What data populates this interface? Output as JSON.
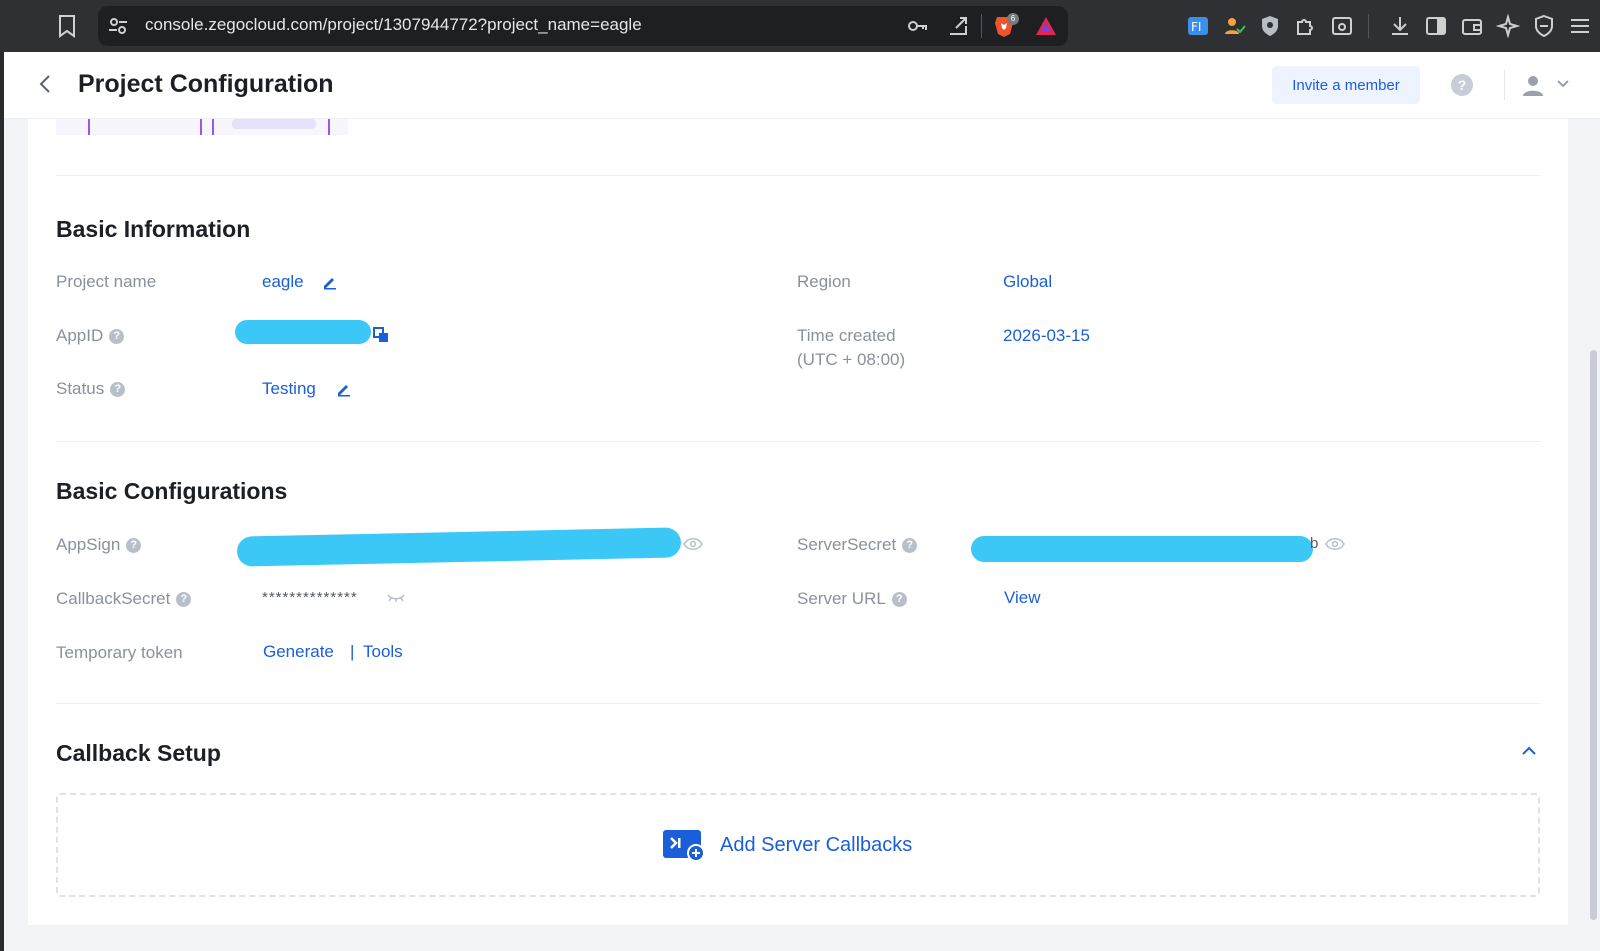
{
  "browser": {
    "url": "console.zegocloud.com/project/1307944772?project_name=eagle",
    "extension_icons": [
      "bookmark-icon",
      "site-settings-icon",
      "key-icon",
      "share-icon",
      "brave-shield-icon",
      "brave-rewards-icon",
      "translate-icon",
      "user-check-icon",
      "shield-icon",
      "puzzle-icon",
      "screenshot-icon",
      "download-icon",
      "sidebar-icon",
      "wallet-icon",
      "ai-sparkle-icon",
      "vpn-icon",
      "menu-icon"
    ],
    "brave_badge_count": "6"
  },
  "header": {
    "title": "Project Configuration",
    "invite_label": "Invite a member",
    "help_glyph": "?"
  },
  "basic_info": {
    "section_title": "Basic Information",
    "project_name_label": "Project name",
    "project_name_value": "eagle",
    "appid_label": "AppID",
    "status_label": "Status",
    "status_value": "Testing",
    "region_label": "Region",
    "region_value": "Global",
    "time_created_label": "Time created",
    "time_created_tz": "(UTC + 08:00)",
    "time_created_value": "2026-03-15"
  },
  "basic_config": {
    "section_title": "Basic Configurations",
    "appsign_label": "AppSign",
    "callback_secret_label": "CallbackSecret",
    "callback_secret_value": "**************",
    "temp_token_label": "Temporary token",
    "generate_label": "Generate",
    "separator": "|",
    "tools_label": "Tools",
    "server_secret_label": "ServerSecret",
    "server_secret_tail": "b",
    "server_url_label": "Server URL",
    "server_url_link": "View"
  },
  "callback": {
    "section_title": "Callback Setup",
    "add_label": "Add Server Callbacks"
  },
  "help_glyph": "?",
  "colors": {
    "accent": "#1a5fd9",
    "redaction": "#3cc8f6",
    "label_gray": "#8a909c",
    "title_dark": "#1c1f26"
  }
}
